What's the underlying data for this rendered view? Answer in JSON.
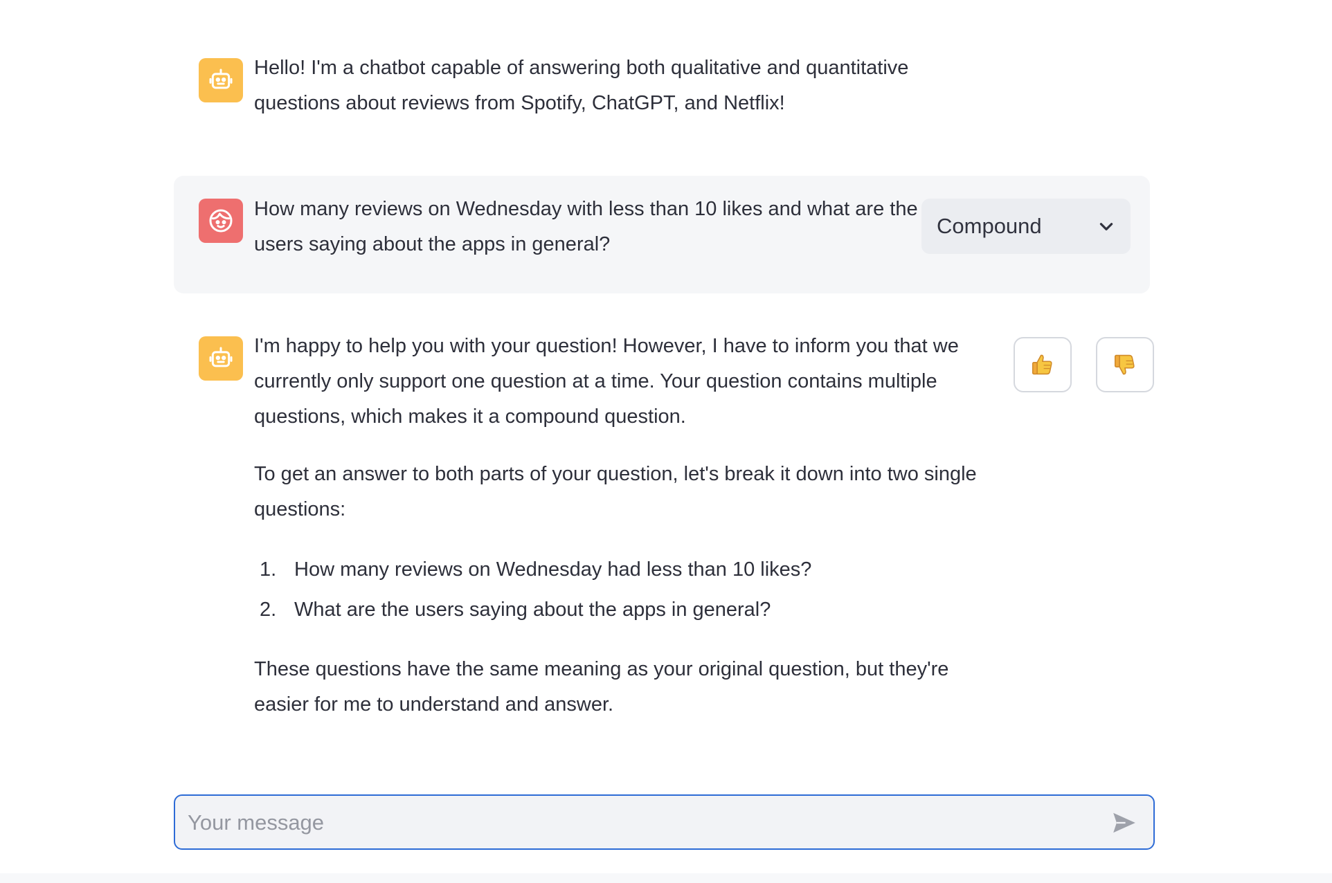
{
  "messages": [
    {
      "role": "assistant",
      "avatar_icon": "robot-icon",
      "text": "Hello! I'm a chatbot capable of answering both qualitative and quantitative questions about reviews from Spotify, ChatGPT, and Netflix!"
    },
    {
      "role": "user",
      "avatar_icon": "face-icon",
      "text": "How many reviews on Wednesday with less than 10 likes and what are the users saying about the apps in general?",
      "question_type": "Compound"
    },
    {
      "role": "assistant",
      "avatar_icon": "robot-icon",
      "paragraph1": "I'm happy to help you with your question! However, I have to inform you that we currently only support one question at a time. Your question contains multiple questions, which makes it a compound question.",
      "paragraph2": "To get an answer to both parts of your question, let's break it down into two single questions:",
      "list": [
        {
          "num": "1.",
          "text": "How many reviews on Wednesday had less than 10 likes?"
        },
        {
          "num": "2.",
          "text": "What are the users saying about the apps in general?"
        }
      ],
      "paragraph3": "These questions have the same meaning as your original question, but they're easier for me to understand and answer.",
      "feedback": {
        "thumbs_up_icon": "thumbs-up-icon",
        "thumbs_down_icon": "thumbs-down-icon"
      }
    }
  ],
  "chat_input": {
    "placeholder": "Your message",
    "value": "",
    "send_icon": "send-icon"
  },
  "colors": {
    "bot_avatar": "#fbbf4f",
    "user_avatar": "#ee6f6f",
    "input_border": "#2d6bd6",
    "user_bubble": "#f5f6f8"
  }
}
